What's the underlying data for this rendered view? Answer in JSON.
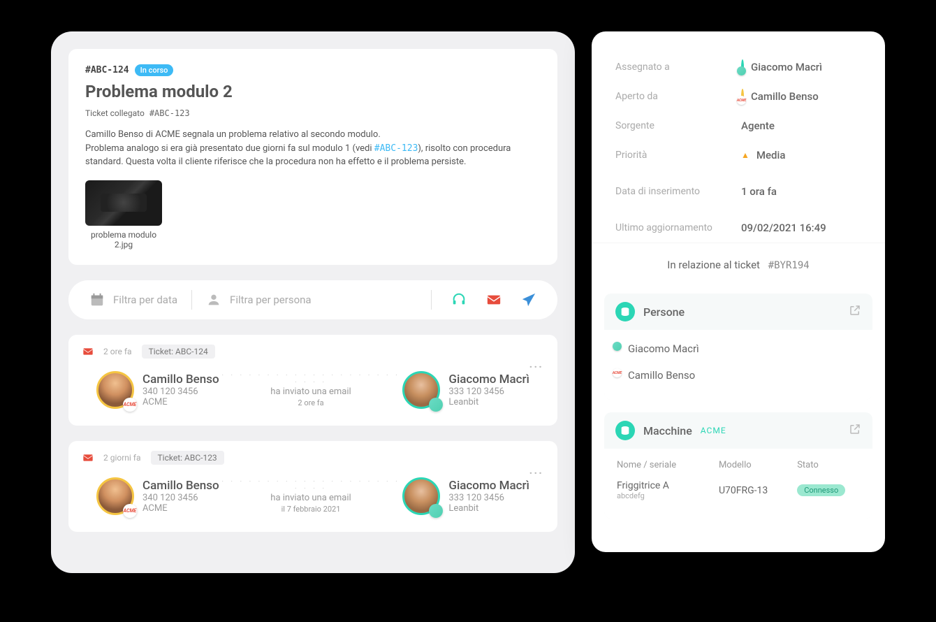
{
  "ticket": {
    "id": "#ABC-124",
    "status": "In corso",
    "title": "Problema modulo 2",
    "linked_label": "Ticket collegato",
    "linked_id": "#ABC-123",
    "desc_line1": "Camillo Benso di ACME segnala un problema relativo al secondo modulo.",
    "desc_line2a": "Problema analogo si era già presentato due giorni fa sul modulo 1 (vedi ",
    "desc_link": "#ABC-123",
    "desc_line2b": "), risolto con procedura standard. Questa volta il cliente riferisce che la procedura non ha effetto e il problema persiste.",
    "attachment": "problema modulo 2.jpg"
  },
  "filters": {
    "date": "Filtra per data",
    "person": "Filtra per persona"
  },
  "events": [
    {
      "time": "2 ore fa",
      "ticket_label": "Ticket: ABC-124",
      "from": {
        "name": "Camillo Benso",
        "phone": "340 120 3456",
        "org": "ACME"
      },
      "action": "ha inviato una email",
      "when": "2 ore fa",
      "to": {
        "name": "Giacomo Macrì",
        "phone": "333 120 3456",
        "org": "Leanbit"
      }
    },
    {
      "time": "2 giorni fa",
      "ticket_label": "Ticket: ABC-123",
      "from": {
        "name": "Camillo Benso",
        "phone": "340 120 3456",
        "org": "ACME"
      },
      "action": "ha inviato una email",
      "when": "il 7 febbraio 2021",
      "to": {
        "name": "Giacomo Macrì",
        "phone": "333 120 3456",
        "org": "Leanbit"
      }
    }
  ],
  "sidebar": {
    "rows": {
      "assigned_label": "Assegnato a",
      "assigned_value": "Giacomo Macrì",
      "opened_label": "Aperto da",
      "opened_value": "Camillo Benso",
      "source_label": "Sorgente",
      "source_value": "Agente",
      "priority_label": "Priorità",
      "priority_value": "Media",
      "created_label": "Data di inserimento",
      "created_value": "1 ora fa",
      "updated_label": "Ultimo aggiornamento",
      "updated_value": "09/02/2021 16:49"
    },
    "related_label": "In relazione al ticket",
    "related_id": "#BYR194",
    "persone_title": "Persone",
    "persone": [
      "Giacomo Macrì",
      "Camillo Benso"
    ],
    "machines_title": "Macchine",
    "machines_org": "ACME",
    "machines_headers": {
      "name": "Nome / seriale",
      "model": "Modello",
      "state": "Stato"
    },
    "machines": [
      {
        "name": "Friggitrice A",
        "serial": "abcdefg",
        "model": "U70FRG-13",
        "state": "Connesso"
      }
    ]
  }
}
